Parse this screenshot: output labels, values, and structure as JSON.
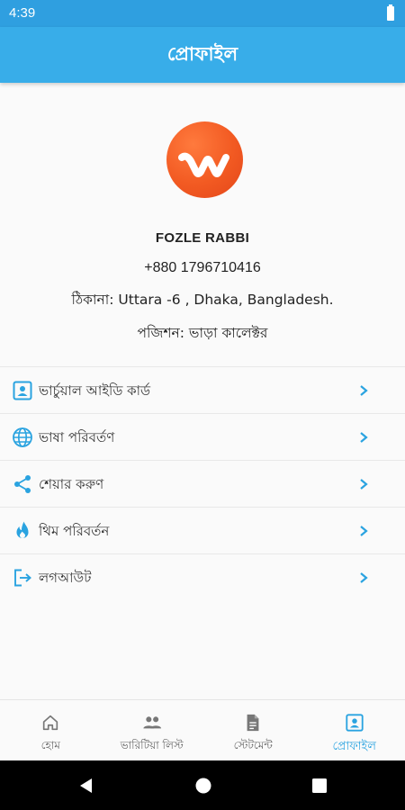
{
  "status_bar": {
    "time": "4:39"
  },
  "app_bar": {
    "title": "প্রোফাইল"
  },
  "profile": {
    "name": "FOZLE RABBI",
    "phone": "+880 1796710416",
    "address": "ঠিকানা: Uttara -6 , Dhaka, Bangladesh.",
    "position": "পজিশন: ভাড়া কালেক্টর"
  },
  "menu": {
    "items": [
      {
        "label": "ভার্চুয়াল আইডি কার্ড",
        "icon": "id-card-icon"
      },
      {
        "label": "ভাষা পরিবর্তণ",
        "icon": "globe-icon"
      },
      {
        "label": "শেয়ার করুণ",
        "icon": "share-icon"
      },
      {
        "label": "থিম পরিবর্তন",
        "icon": "flame-icon"
      },
      {
        "label": "লগআউট",
        "icon": "logout-icon"
      }
    ]
  },
  "bottom_nav": {
    "items": [
      {
        "label": "হোম",
        "icon": "home-icon"
      },
      {
        "label": "ভারিটিয়া লিস্ট",
        "icon": "people-icon"
      },
      {
        "label": "স্টেটমেন্ট",
        "icon": "document-icon"
      },
      {
        "label": "প্রোফাইল",
        "icon": "profile-icon",
        "active": true
      }
    ]
  },
  "colors": {
    "primary": "#38ade9",
    "status_bar": "#2f9fe0",
    "logo": "#f25a22",
    "icon": "#2aa3e0"
  }
}
